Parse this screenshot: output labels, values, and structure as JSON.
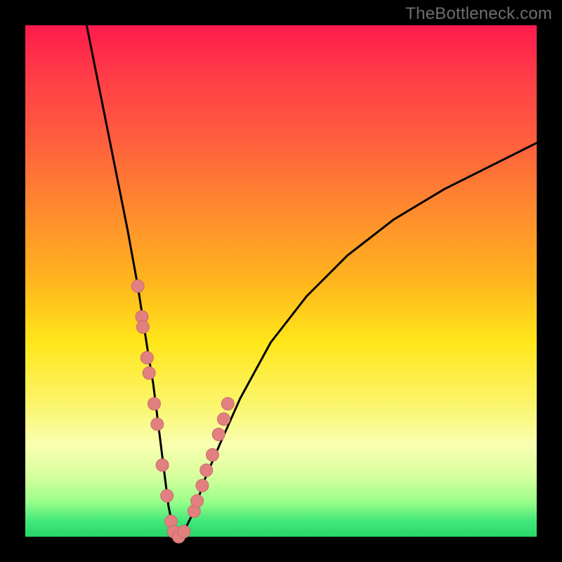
{
  "watermark": "TheBottleneck.com",
  "colors": {
    "background": "#000000",
    "curve_stroke": "#000000",
    "marker_fill": "#e28080",
    "marker_stroke": "#c96b6b"
  },
  "chart_data": {
    "type": "line",
    "title": "",
    "xlabel": "",
    "ylabel": "",
    "xlim": [
      0,
      100
    ],
    "ylim": [
      0,
      100
    ],
    "grid": false,
    "series": [
      {
        "name": "bottleneck-curve",
        "x": [
          12,
          14,
          16,
          18,
          20,
          22,
          24,
          25,
          26,
          27,
          28,
          29,
          30,
          31,
          33,
          35,
          38,
          42,
          48,
          55,
          63,
          72,
          82,
          92,
          100
        ],
        "y": [
          100,
          90,
          80,
          70,
          60,
          49,
          36,
          30,
          22,
          14,
          6,
          1,
          0,
          1,
          5,
          11,
          18,
          27,
          38,
          47,
          55,
          62,
          68,
          73,
          77
        ]
      }
    ],
    "markers": {
      "name": "highlight-points",
      "x": [
        22.0,
        22.8,
        23.0,
        23.8,
        24.2,
        25.2,
        25.8,
        26.8,
        27.7,
        28.5,
        29.0,
        30.0,
        31.0,
        33.0,
        33.6,
        34.6,
        35.4,
        36.6,
        37.8,
        38.8,
        39.6
      ],
      "y": [
        49,
        43,
        41,
        35,
        32,
        26,
        22,
        14,
        8,
        3,
        1,
        0,
        1,
        5,
        7,
        10,
        13,
        16,
        20,
        23,
        26
      ]
    }
  }
}
